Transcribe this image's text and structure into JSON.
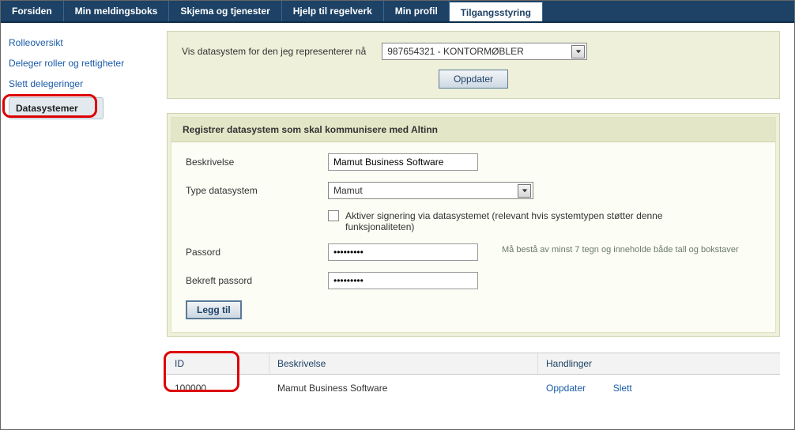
{
  "tabs": [
    "Forsiden",
    "Min meldingsboks",
    "Skjema og tjenester",
    "Hjelp til regelverk",
    "Min profil",
    "Tilgangsstyring"
  ],
  "active_tab_index": 5,
  "sidebar": {
    "links": [
      "Rolleoversikt",
      "Deleger roller og rettigheter",
      "Slett delegeringer"
    ],
    "active": "Datasystemer"
  },
  "top_panel": {
    "label": "Vis datasystem for den jeg representerer nå",
    "selected": "987654321 - KONTORMØBLER",
    "update_button": "Oppdater"
  },
  "form_panel": {
    "heading": "Registrer datasystem som skal kommunisere med Altinn",
    "desc_label": "Beskrivelse",
    "desc_value": "Mamut Business Software",
    "type_label": "Type datasystem",
    "type_selected": "Mamut",
    "checkbox_label": "Aktiver signering via datasystemet (relevant hvis systemtypen støtter denne funksjonaliteten)",
    "password_label": "Passord",
    "password_value": "•••••••••",
    "password_help": "Må bestå av minst 7 tegn og inneholde både tall og bokstaver",
    "confirm_label": "Bekreft passord",
    "confirm_value": "•••••••••",
    "add_button": "Legg til"
  },
  "table": {
    "headers": {
      "id": "ID",
      "desc": "Beskrivelse",
      "actions": "Handlinger"
    },
    "row": {
      "id": "100000",
      "desc": "Mamut Business Software",
      "action_update": "Oppdater",
      "action_delete": "Slett"
    }
  }
}
